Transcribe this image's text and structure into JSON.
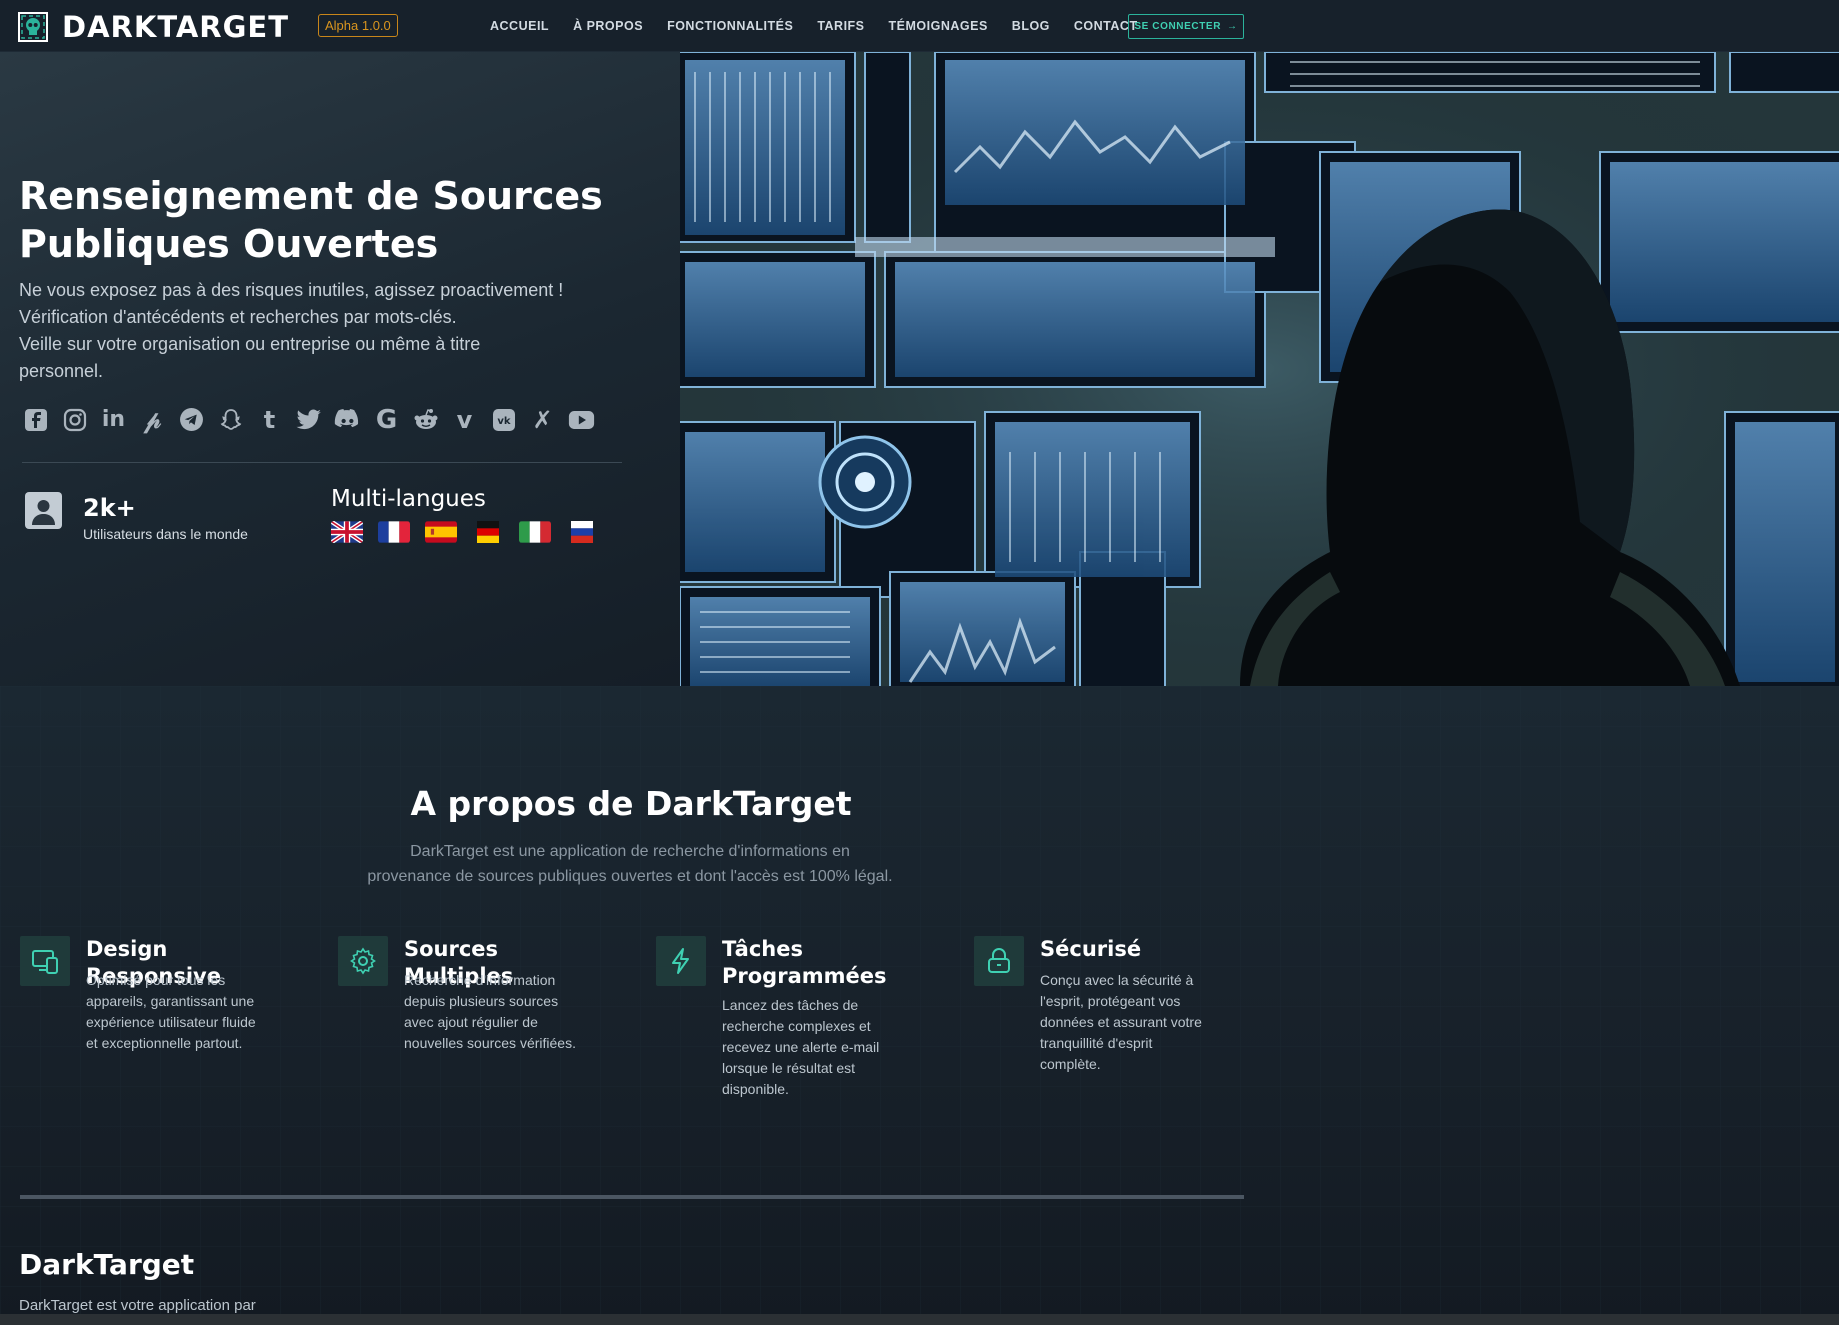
{
  "nav": {
    "brand": "DARKTARGET",
    "version_badge": "Alpha 1.0.0",
    "menu": [
      "ACCUEIL",
      "À PROPOS",
      "FONCTIONNALITÉS",
      "TARIFS",
      "TÉMOIGNAGES",
      "BLOG",
      "CONTACT"
    ],
    "login_label": "SE CONNECTER"
  },
  "hero": {
    "title_line1": "Renseignement de Sources",
    "title_line2": "Publiques Ouvertes",
    "text_line1": "Ne vous exposez pas à des risques inutiles, agissez proactivement !",
    "text_line2": "Vérification d'antécédents et recherches par mots-clés.",
    "text_line3": "Veille sur votre organisation ou entreprise ou même à titre",
    "text_line4": "personnel.",
    "socials": [
      "facebook-icon",
      "instagram-icon",
      "linkedin-icon",
      "pinterest-icon",
      "telegram-icon",
      "snapchat-icon",
      "tumblr-icon",
      "twitter-icon",
      "discord-icon",
      "google-icon",
      "reddit-icon",
      "vimeo-icon",
      "vk-icon",
      "xing-icon",
      "youtube-icon"
    ],
    "stat_value": "2k+",
    "stat_label": "Utilisateurs dans le monde",
    "languages_title": "Multi-langues",
    "flags": [
      "uk-flag",
      "france-flag",
      "spain-flag",
      "germany-flag",
      "italy-flag",
      "russia-flag"
    ]
  },
  "about": {
    "title": "A propos de DarkTarget",
    "subtitle_line1": "DarkTarget est une application de recherche d'informations en",
    "subtitle_line2": "provenance de sources publiques ouvertes et dont l'accès est 100% légal.",
    "features": [
      {
        "icon": "responsive-devices-icon",
        "title": "Design Responsive",
        "text": [
          "Optimisé pour tous les",
          "appareils, garantissant une",
          "expérience utilisateur fluide",
          "et exceptionnelle partout."
        ]
      },
      {
        "icon": "gear-icon",
        "title": "Sources Multiples",
        "text": [
          "Recherche d'information",
          "depuis plusieurs sources",
          "avec ajout régulier de",
          "nouvelles sources vérifiées."
        ]
      },
      {
        "icon": "lightning-icon",
        "title": "Tâches Programmées",
        "text": [
          "Lancez des tâches de",
          "recherche complexes et",
          "recevez une alerte e-mail",
          "lorsque le résultat est",
          "disponible."
        ]
      },
      {
        "icon": "lock-icon",
        "title": "Sécurisé",
        "text": [
          "Conçu avec la sécurité à",
          "l'esprit, protégeant vos",
          "données et assurant votre",
          "tranquillité d'esprit",
          "complète."
        ]
      }
    ]
  },
  "footer": {
    "title": "DarkTarget",
    "text": "DarkTarget est votre application par"
  },
  "colors": {
    "accent": "#3fd0b2",
    "badge": "#d9951f",
    "background": "#141c25"
  }
}
